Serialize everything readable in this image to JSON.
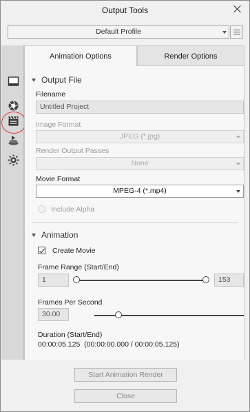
{
  "window": {
    "title": "Output Tools"
  },
  "profile": {
    "selected": "Default Profile"
  },
  "tabs": [
    {
      "label": "Animation Options",
      "active": true
    },
    {
      "label": "Render Options",
      "active": false
    }
  ],
  "sidebar": {
    "icons": [
      "monitor-icon",
      "aperture-icon",
      "clapperboard-icon",
      "render-stack-icon",
      "sun-gear-icon"
    ],
    "highlighted": "clapperboard-icon"
  },
  "output_file": {
    "section_title": "Output File",
    "filename_label": "Filename",
    "filename_value": "Untitled Project",
    "image_format_label": "Image Format",
    "image_format_value": "JPEG (*.jpg)",
    "render_passes_label": "Render Output Passes",
    "render_passes_value": "None",
    "movie_format_label": "Movie Format",
    "movie_format_value": "MPEG-4 (*.mp4)",
    "include_alpha_label": "Include Alpha"
  },
  "animation": {
    "section_title": "Animation",
    "create_movie_label": "Create Movie",
    "create_movie_checked": true,
    "frame_range_label": "Frame Range (Start/End)",
    "frame_start": "1",
    "frame_end": "153",
    "fps_label": "Frames Per Second",
    "fps_value": "30.00",
    "duration_label": "Duration (Start/End)",
    "duration_value": "00:00:05.125  (00:00:00.000 / 00:00:05.125)"
  },
  "footer": {
    "start_label": "Start Animation Render",
    "close_label": "Close"
  },
  "colors": {
    "highlight_circle": "#e23030"
  }
}
